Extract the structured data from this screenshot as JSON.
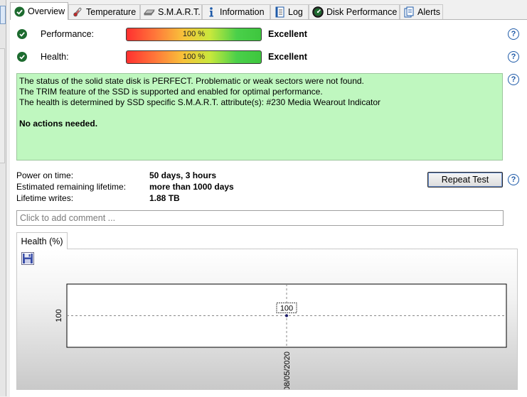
{
  "tabs": [
    {
      "label": "Overview",
      "icon": "check-circle-icon",
      "active": true
    },
    {
      "label": "Temperature",
      "icon": "thermometer-icon",
      "active": false
    },
    {
      "label": "S.M.A.R.T.",
      "icon": "disk-drive-icon",
      "active": false
    },
    {
      "label": "Information",
      "icon": "info-icon",
      "active": false
    },
    {
      "label": "Log",
      "icon": "log-document-icon",
      "active": false
    },
    {
      "label": "Disk Performance",
      "icon": "gauge-icon",
      "active": false
    },
    {
      "label": "Alerts",
      "icon": "alert-document-icon",
      "active": false
    }
  ],
  "performance": {
    "label": "Performance:",
    "percent_text": "100 %",
    "percent": 100,
    "rating": "Excellent"
  },
  "health": {
    "label": "Health:",
    "percent_text": "100 %",
    "percent": 100,
    "rating": "Excellent"
  },
  "message": {
    "line1": "The status of the solid state disk is PERFECT. Problematic or weak sectors were not found.",
    "line2": "The TRIM feature of the SSD is supported and enabled for optimal performance.",
    "line3": "The health is determined by SSD specific S.M.A.R.T. attribute(s):  #230 Media Wearout Indicator",
    "action": "No actions needed."
  },
  "info": {
    "power_on_label": "Power on time:",
    "power_on_value": "50 days, 3 hours",
    "lifetime_label": "Estimated remaining lifetime:",
    "lifetime_value": "more than 1000 days",
    "writes_label": "Lifetime writes:",
    "writes_value": "1.88 TB"
  },
  "buttons": {
    "repeat_test": "Repeat Test",
    "help": "?"
  },
  "comment": {
    "placeholder": "Click to add comment ...",
    "value": ""
  },
  "chart_tab": {
    "label": "Health (%)"
  },
  "colors": {
    "message_bg": "#bff7bf",
    "check_green": "#1d6b2f",
    "help_blue": "#1e5aa8"
  },
  "chart_data": {
    "type": "line",
    "x": [
      "08/05/2020"
    ],
    "y": [
      100
    ],
    "tick_labels_y": [
      "100"
    ],
    "tick_labels_x": [
      "08/05/2020"
    ],
    "data_labels": [
      "100"
    ],
    "grid": true
  }
}
